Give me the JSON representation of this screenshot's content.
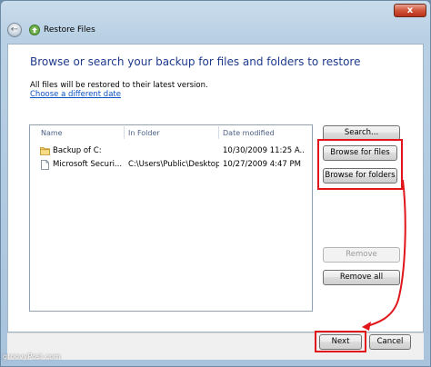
{
  "window": {
    "title": "Restore Files",
    "close_label": "x"
  },
  "page": {
    "heading": "Browse or search your backup for files and folders to restore",
    "info_text": "All files will be restored to their latest version.",
    "change_date_link": "Choose a different date"
  },
  "file_list": {
    "columns": [
      "Name",
      "In Folder",
      "Date modified"
    ],
    "rows": [
      {
        "name": "Backup of C:",
        "folder": "",
        "date": "10/30/2009 11:25 A...",
        "icon": "folder-icon"
      },
      {
        "name": "Microsoft Securi...",
        "folder": "C:\\Users\\Public\\Desktop",
        "date": "10/27/2009 4:47 PM",
        "icon": "file-icon"
      }
    ]
  },
  "buttons": {
    "search": "Search...",
    "browse_files": "Browse for files",
    "browse_folders": "Browse for folders",
    "remove": "Remove",
    "remove_all": "Remove all",
    "next": "Next",
    "cancel": "Cancel"
  },
  "watermark": "groovyPost.com",
  "colors": {
    "highlight": "#e0161b",
    "heading": "#1e3a8c",
    "link": "#0a52c5"
  }
}
